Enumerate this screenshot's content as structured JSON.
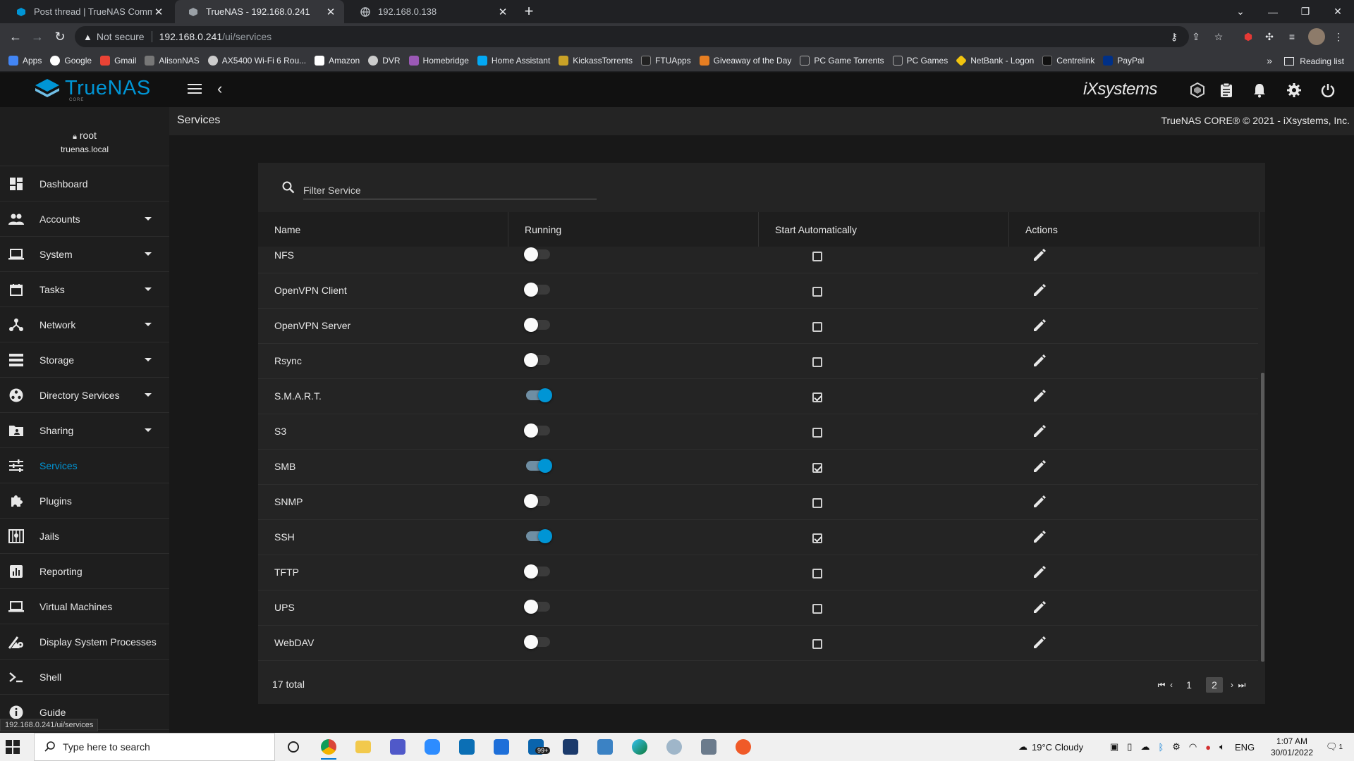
{
  "browser": {
    "tabs": [
      {
        "label": "Post thread | TrueNAS Communit",
        "active": false
      },
      {
        "label": "TrueNAS - 192.168.0.241",
        "active": true
      },
      {
        "label": "192.168.0.138",
        "active": false
      }
    ],
    "new_tab": "+",
    "url_security": "Not secure",
    "url_host": "192.168.0.241",
    "url_path": "/ui/services",
    "bookmarks": [
      {
        "label": "Apps",
        "color": "#4285f4"
      },
      {
        "label": "Google",
        "color": "#ffffff"
      },
      {
        "label": "Gmail",
        "color": "#ea4335"
      },
      {
        "label": "AlisonNAS",
        "color": "#777777"
      },
      {
        "label": "AX5400 Wi-Fi 6 Rou...",
        "color": "#cccccc"
      },
      {
        "label": "Amazon",
        "color": "#ffffff"
      },
      {
        "label": "DVR",
        "color": "#cccccc"
      },
      {
        "label": "Homebridge",
        "color": "#9b59b6"
      },
      {
        "label": "Home Assistant",
        "color": "#03a9f4"
      },
      {
        "label": "KickassTorrents",
        "color": "#c9a227"
      },
      {
        "label": "FTUApps",
        "color": "#222222"
      },
      {
        "label": "Giveaway of the Day",
        "color": "#e67e22"
      },
      {
        "label": "PC Game Torrents",
        "color": "#aaaaaa"
      },
      {
        "label": "PC Games",
        "color": "#aaaaaa"
      },
      {
        "label": "NetBank - Logon",
        "color": "#f1c40f"
      },
      {
        "label": "Centrelink",
        "color": "#111111"
      },
      {
        "label": "PayPal",
        "color": "#003087"
      }
    ],
    "reading_list": "Reading list",
    "status_url": "192.168.0.241/ui/services"
  },
  "app": {
    "logo_text": "TrueNAS",
    "logo_sub": "CORE",
    "vendor": "iXsystems",
    "user": {
      "name": "root",
      "host": "truenas.local"
    },
    "nav": [
      {
        "label": "Dashboard",
        "icon": "dashboard-icon",
        "caret": false,
        "active": false
      },
      {
        "label": "Accounts",
        "icon": "accounts-icon",
        "caret": true,
        "active": false
      },
      {
        "label": "System",
        "icon": "laptop-icon",
        "caret": true,
        "active": false
      },
      {
        "label": "Tasks",
        "icon": "calendar-icon",
        "caret": true,
        "active": false
      },
      {
        "label": "Network",
        "icon": "network-icon",
        "caret": true,
        "active": false
      },
      {
        "label": "Storage",
        "icon": "storage-icon",
        "caret": true,
        "active": false
      },
      {
        "label": "Directory Services",
        "icon": "directory-icon",
        "caret": true,
        "active": false
      },
      {
        "label": "Sharing",
        "icon": "folder-share-icon",
        "caret": true,
        "active": false
      },
      {
        "label": "Services",
        "icon": "tune-icon",
        "caret": false,
        "active": true
      },
      {
        "label": "Plugins",
        "icon": "puzzle-icon",
        "caret": false,
        "active": false
      },
      {
        "label": "Jails",
        "icon": "jail-icon",
        "caret": false,
        "active": false
      },
      {
        "label": "Reporting",
        "icon": "chart-icon",
        "caret": false,
        "active": false
      },
      {
        "label": "Virtual Machines",
        "icon": "monitor-icon",
        "caret": false,
        "active": false
      },
      {
        "label": "Display System Processes",
        "icon": "processes-icon",
        "caret": false,
        "active": false
      },
      {
        "label": "Shell",
        "icon": "shell-icon",
        "caret": false,
        "active": false
      },
      {
        "label": "Guide",
        "icon": "info-icon",
        "caret": false,
        "active": false
      }
    ],
    "page_title": "Services",
    "copyright": "TrueNAS CORE® © 2021 - iXsystems, Inc.",
    "accent": "#0095d5"
  },
  "services": {
    "filter_placeholder": "Filter Service",
    "columns": [
      "Name",
      "Running",
      "Start Automatically",
      "Actions"
    ],
    "rows": [
      {
        "name": "NFS",
        "running": false,
        "auto": false
      },
      {
        "name": "OpenVPN Client",
        "running": false,
        "auto": false
      },
      {
        "name": "OpenVPN Server",
        "running": false,
        "auto": false
      },
      {
        "name": "Rsync",
        "running": false,
        "auto": false
      },
      {
        "name": "S.M.A.R.T.",
        "running": true,
        "auto": true
      },
      {
        "name": "S3",
        "running": false,
        "auto": false
      },
      {
        "name": "SMB",
        "running": true,
        "auto": true
      },
      {
        "name": "SNMP",
        "running": false,
        "auto": false
      },
      {
        "name": "SSH",
        "running": true,
        "auto": true
      },
      {
        "name": "TFTP",
        "running": false,
        "auto": false
      },
      {
        "name": "UPS",
        "running": false,
        "auto": false
      },
      {
        "name": "WebDAV",
        "running": false,
        "auto": false
      }
    ],
    "total": "17 total",
    "pages": [
      "1",
      "2"
    ],
    "current_page": "2"
  },
  "taskbar": {
    "search_placeholder": "Type here to search",
    "mail_badge": "99+",
    "weather": "19°C  Cloudy",
    "lang": "ENG",
    "time": "1:07 AM",
    "date": "30/01/2022",
    "notif_count": "1"
  }
}
